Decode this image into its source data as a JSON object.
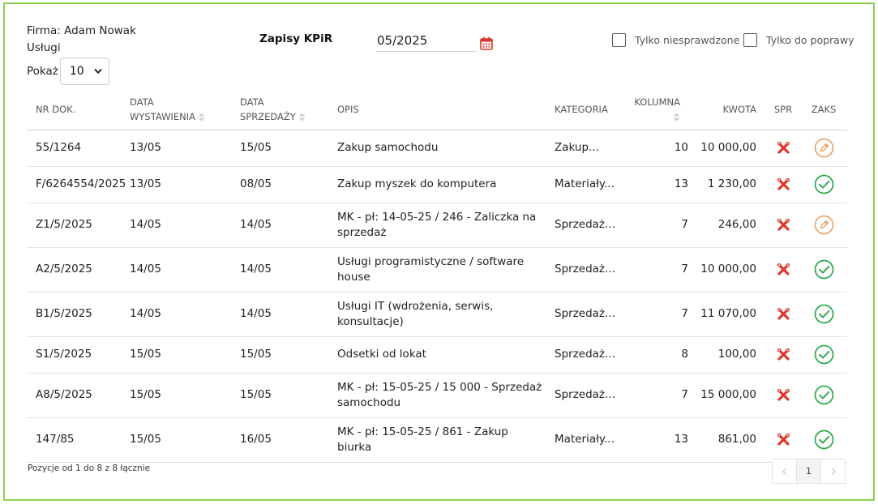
{
  "header": {
    "firm_label": "Firma: Adam Nowak",
    "firm_sub": "Usługi",
    "show_label": "Pokaż",
    "show_value": "10",
    "title": "Zapisy KPiR",
    "date_value": "05/2025",
    "filter_unchecked_label": "Tylko niesprawdzone",
    "filter_fix_label": "Tylko do poprawy"
  },
  "table": {
    "headers": {
      "nr": "NR DOK.",
      "wy_1": "DATA",
      "wy_2": "WYSTAWIENIA",
      "sp_1": "DATA",
      "sp_2": "SPRZEDAŻY",
      "opis": "OPIS",
      "kat": "KATEGORIA",
      "kol": "KOLUMNA",
      "kwota": "KWOTA",
      "spr": "SPR",
      "zaks": "ZAKS"
    },
    "rows": [
      {
        "nr": "55/1264",
        "wy": "13/05",
        "sp": "15/05",
        "opis": "Zakup samochodu",
        "kat": "Zakup...",
        "kol": "10",
        "kwota": "10 000,00",
        "status": "edit"
      },
      {
        "nr": "F/6264554/2025",
        "wy": "13/05",
        "sp": "08/05",
        "opis": "Zakup myszek do komputera",
        "kat": "Materiały...",
        "kol": "13",
        "kwota": "1 230,00",
        "status": "check"
      },
      {
        "nr": "Z1/5/2025",
        "wy": "14/05",
        "sp": "14/05",
        "opis": "MK - pł: 14-05-25 / 246 - Zaliczka na sprzedaż",
        "kat": "Sprzedaż...",
        "kol": "7",
        "kwota": "246,00",
        "status": "edit"
      },
      {
        "nr": "A2/5/2025",
        "wy": "14/05",
        "sp": "14/05",
        "opis": "Usługi programistyczne / software house",
        "kat": "Sprzedaż...",
        "kol": "7",
        "kwota": "10 000,00",
        "status": "check"
      },
      {
        "nr": "B1/5/2025",
        "wy": "14/05",
        "sp": "14/05",
        "opis": "Usługi IT (wdrożenia, serwis, konsultacje)",
        "kat": "Sprzedaż...",
        "kol": "7",
        "kwota": "11 070,00",
        "status": "check"
      },
      {
        "nr": "S1/5/2025",
        "wy": "15/05",
        "sp": "15/05",
        "opis": "Odsetki od lokat",
        "kat": "Sprzedaż...",
        "kol": "8",
        "kwota": "100,00",
        "status": "check"
      },
      {
        "nr": "A8/5/2025",
        "wy": "15/05",
        "sp": "15/05",
        "opis": "MK - pł: 15-05-25 / 15 000 - Sprzedaż samochodu",
        "kat": "Sprzedaż...",
        "kol": "7",
        "kwota": "15 000,00",
        "status": "check"
      },
      {
        "nr": "147/85",
        "wy": "15/05",
        "sp": "16/05",
        "opis": "MK - pł: 15-05-25 / 861 - Zakup biurka",
        "kat": "Materiały...",
        "kol": "13",
        "kwota": "861,00",
        "status": "check"
      }
    ]
  },
  "footer": {
    "info": "Pozycje od 1 do 8 z 8 łącznie",
    "page": "1"
  },
  "colors": {
    "border": "#8fd14f",
    "tools_red": "#e0362c",
    "check_green": "#2aa84a",
    "edit_orange": "#e8995a",
    "calendar_red": "#d8352a"
  }
}
